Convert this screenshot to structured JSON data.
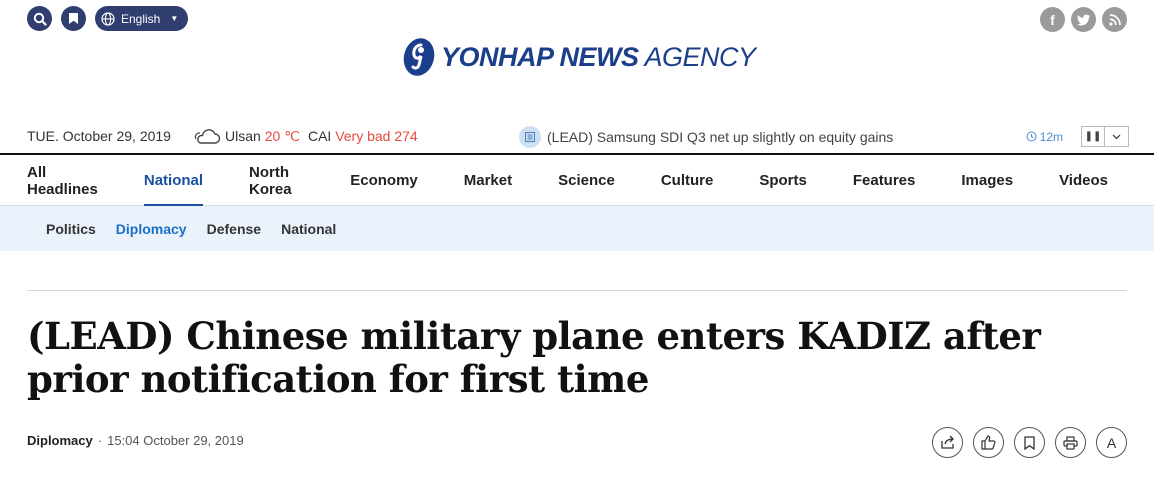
{
  "header": {
    "language": "English",
    "logo_bold": "YONHAP NEWS",
    "logo_light": "AGENCY",
    "social": [
      "facebook-icon",
      "twitter-icon",
      "rss-icon"
    ]
  },
  "info": {
    "date": "TUE. October 29, 2019",
    "city": "Ulsan",
    "temperature": "20 ℃",
    "cai_label": "CAI",
    "cai_value": "Very bad 274"
  },
  "ticker": {
    "headline": "(LEAD) Samsung SDI Q3 net up slightly on equity gains",
    "ago": "12m"
  },
  "nav": {
    "items": [
      {
        "label": "All Headlines"
      },
      {
        "label": "National"
      },
      {
        "label": "North Korea"
      },
      {
        "label": "Economy"
      },
      {
        "label": "Market"
      },
      {
        "label": "Science"
      },
      {
        "label": "Culture"
      },
      {
        "label": "Sports"
      },
      {
        "label": "Features"
      },
      {
        "label": "Images"
      },
      {
        "label": "Videos"
      }
    ],
    "active": "National"
  },
  "subnav": {
    "items": [
      {
        "label": "Politics"
      },
      {
        "label": "Diplomacy"
      },
      {
        "label": "Defense"
      },
      {
        "label": "National"
      }
    ],
    "active": "Diplomacy"
  },
  "article": {
    "title": "(LEAD) Chinese military plane enters KADIZ after prior notification for first time",
    "category": "Diplomacy",
    "separator": "·",
    "datetime": "15:04 October 29, 2019",
    "font_button": "A"
  },
  "colors": {
    "brand": "#2f3e6e",
    "accent": "#1b4fa0",
    "alert": "#e84a3c",
    "subnav_bg": "#eaf2fb"
  }
}
